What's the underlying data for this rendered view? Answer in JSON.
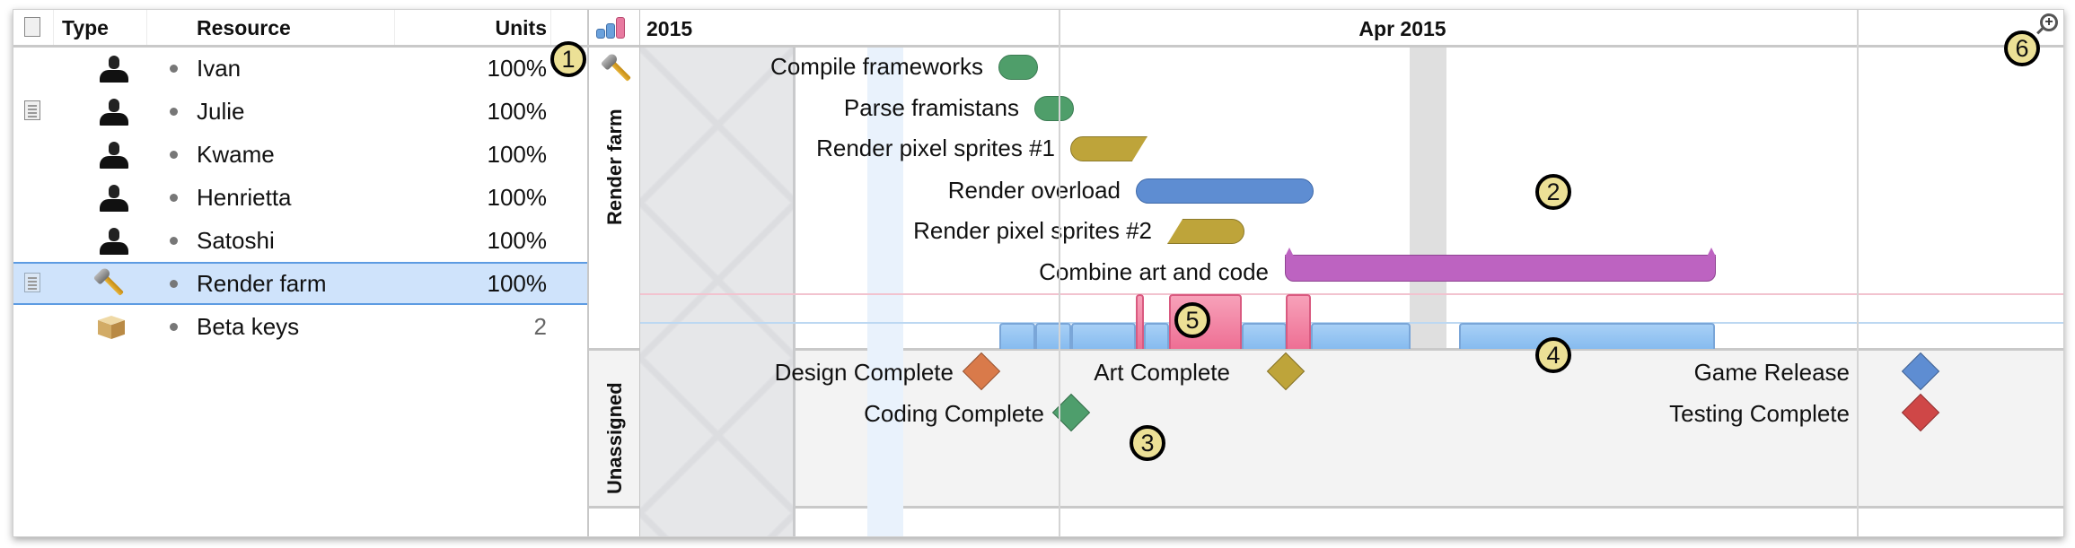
{
  "resources_table": {
    "columns": {
      "notes_icon": "notes-icon",
      "type": "Type",
      "resource": "Resource",
      "units": "Units"
    },
    "rows": [
      {
        "has_note": false,
        "type_icon": "person-icon",
        "name": "Ivan",
        "units": "100%"
      },
      {
        "has_note": true,
        "type_icon": "person-icon",
        "name": "Julie",
        "units": "100%"
      },
      {
        "has_note": false,
        "type_icon": "person-icon",
        "name": "Kwame",
        "units": "100%"
      },
      {
        "has_note": false,
        "type_icon": "person-icon",
        "name": "Henrietta",
        "units": "100%"
      },
      {
        "has_note": false,
        "type_icon": "person-icon",
        "name": "Satoshi",
        "units": "100%"
      },
      {
        "has_note": true,
        "type_icon": "hammer-icon",
        "name": "Render farm",
        "units": "100%",
        "selected": true
      },
      {
        "has_note": false,
        "type_icon": "box-icon",
        "name": "Beta keys",
        "units": "2"
      }
    ]
  },
  "timeline": {
    "header": {
      "year_label": "2015",
      "month_label": "Apr 2015",
      "load_toggle_icon": "resource-load-icon",
      "zoom_icon": "zoom-in-icon"
    },
    "groups": [
      {
        "label": "Render farm",
        "icon": "hammer-icon"
      },
      {
        "label": "Unassigned"
      }
    ],
    "tasks": [
      {
        "name": "Compile frameworks",
        "color": "#4f9e6a"
      },
      {
        "name": "Parse framistans",
        "color": "#4f9e6a"
      },
      {
        "name": "Render pixel sprites #1",
        "color": "#bea43a"
      },
      {
        "name": "Render overload",
        "color": "#5e8dd2"
      },
      {
        "name": "Render pixel sprites #2",
        "color": "#bea43a"
      },
      {
        "name": "Combine art and code",
        "color": "#bd63c1"
      }
    ],
    "milestones": [
      {
        "name": "Design Complete",
        "color": "#d97a4a"
      },
      {
        "name": "Coding Complete",
        "color": "#4e9e6c"
      },
      {
        "name": "Art Complete",
        "color": "#bea43a"
      },
      {
        "name": "Game Release",
        "color": "#5e8dd2"
      },
      {
        "name": "Testing Complete",
        "color": "#cf4747"
      }
    ],
    "load_colors": {
      "normal": "#86bbef",
      "overload": "#ee6f94"
    }
  },
  "callouts": [
    "1",
    "2",
    "3",
    "4",
    "5",
    "6"
  ]
}
